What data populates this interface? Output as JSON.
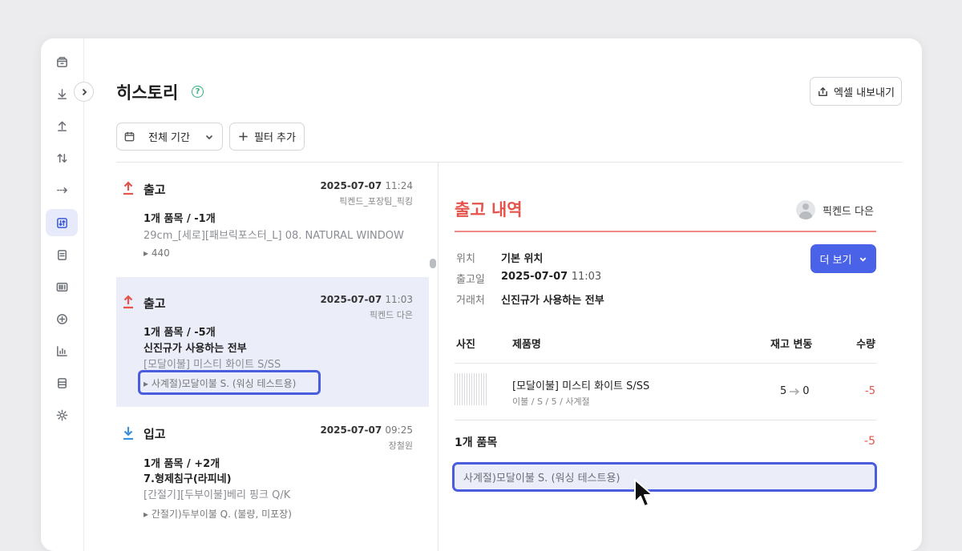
{
  "page": {
    "title": "히스토리",
    "export_label": "엑셀 내보내기"
  },
  "filters": {
    "period_label": "전체 기간",
    "add_filter_label": "필터 추가"
  },
  "history": [
    {
      "type": "출고",
      "date": "2025-07-07",
      "time": "11:24",
      "user": "픽켄드_포장팀_픽킹",
      "summary": "1개 품목 / -1개",
      "lines": [
        {
          "text": "29cm_[세로][패브릭포스터_L] 08. NATURAL WINDOW",
          "style": "g"
        }
      ],
      "location": "440"
    },
    {
      "type": "출고",
      "date": "2025-07-07",
      "time": "11:03",
      "user": "픽켄드 다은",
      "summary": "1개 품목 / -5개",
      "lines": [
        {
          "text": "신진규가 사용하는 전부",
          "style": "b"
        },
        {
          "text": "[모달이불] 미스티 화이트 S/SS",
          "style": "g"
        }
      ],
      "location": "사계절)모달이불 S. (워싱 테스트용)"
    },
    {
      "type": "입고",
      "date": "2025-07-07",
      "time": "09:25",
      "user": "장철원",
      "summary": "1개 품목 / +2개",
      "lines": [
        {
          "text": "7.형제침구(라피네)",
          "style": "b"
        },
        {
          "text": "[간절기][두부이불]베리 핑크 Q/K",
          "style": "g"
        }
      ],
      "location": "간절기)두부이불 Q. (불량, 미포장)"
    }
  ],
  "detail": {
    "title": "출고 내역",
    "user": "픽켄드 다은",
    "more_label": "더 보기",
    "info": [
      {
        "label": "위치",
        "value": "기본 위치"
      },
      {
        "label": "출고일",
        "value": "2025-07-07",
        "time": "11:03"
      },
      {
        "label": "거래처",
        "value": "신진규가 사용하는 전부"
      }
    ],
    "columns": {
      "photo": "사진",
      "name": "제품명",
      "stock": "재고 변동",
      "qty": "수량"
    },
    "item": {
      "name": "[모달이불] 미스티 화이트 S/SS",
      "options": "이불 / S / 5 / 사계절",
      "stock_from": "5",
      "stock_to": "0",
      "qty": "-5"
    },
    "summary": {
      "label": "1개 품목",
      "qty": "-5"
    },
    "location": "사계절)모달이불 S. (워싱 테스트용)"
  },
  "colors": {
    "accent": "#4a62e8",
    "outbound": "#e5534b",
    "inbound": "#3d8fe0",
    "highlight": "#4b5ddf"
  }
}
